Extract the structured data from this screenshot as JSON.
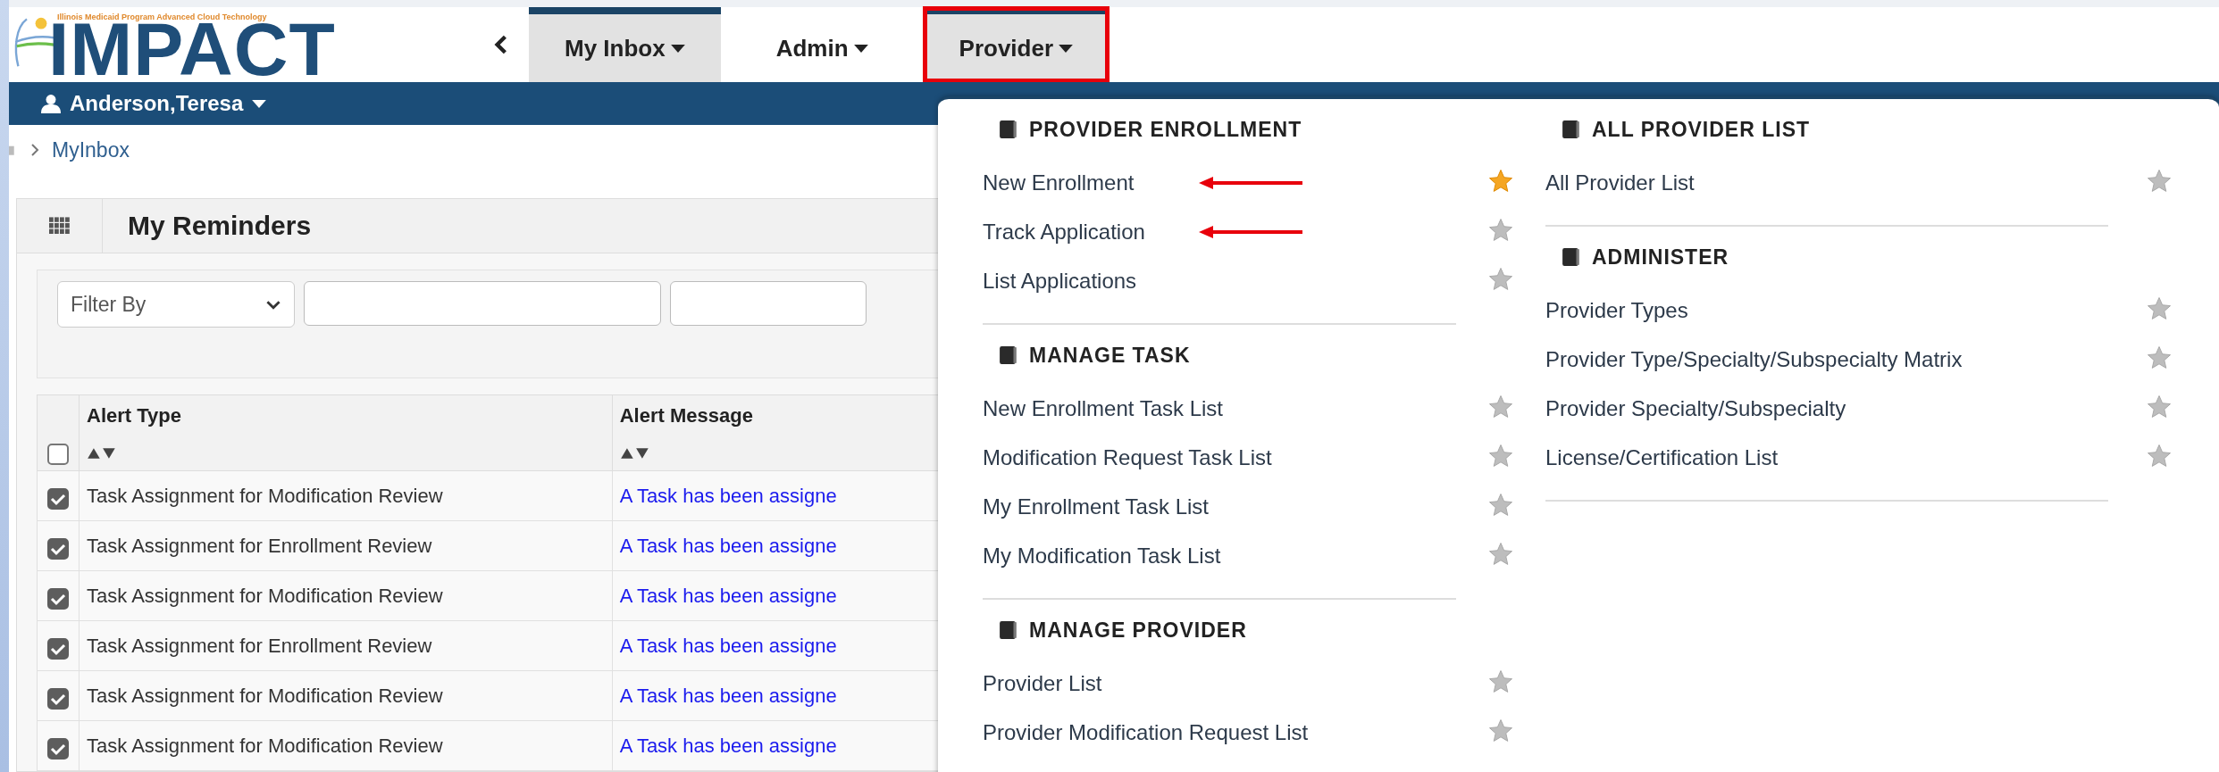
{
  "logo": {
    "name": "IMPACT",
    "tagline": "Illinois Medicaid Program Advanced Cloud Technology"
  },
  "nav": [
    {
      "label": "My Inbox",
      "selected": true,
      "highlighted": false
    },
    {
      "label": "Admin",
      "selected": false,
      "highlighted": false
    },
    {
      "label": "Provider",
      "selected": true,
      "highlighted": true
    }
  ],
  "user": {
    "name": "Anderson,Teresa"
  },
  "breadcrumb": {
    "current": "MyInbox"
  },
  "panel": {
    "title": "My Reminders",
    "filter": {
      "placeholder": "Filter By"
    },
    "table": {
      "columns": [
        "Alert Type",
        "Alert Message"
      ],
      "header_checked": false,
      "rows": [
        {
          "checked": true,
          "alert_type": "Task Assignment for Modification Review",
          "alert_message": "A Task has been assigne"
        },
        {
          "checked": true,
          "alert_type": "Task Assignment for Enrollment Review",
          "alert_message": "A Task has been assigne"
        },
        {
          "checked": true,
          "alert_type": "Task Assignment for Modification Review",
          "alert_message": "A Task has been assigne"
        },
        {
          "checked": true,
          "alert_type": "Task Assignment for Enrollment Review",
          "alert_message": "A Task has been assigne"
        },
        {
          "checked": true,
          "alert_type": "Task Assignment for Modification Review",
          "alert_message": "A Task has been assigne"
        },
        {
          "checked": true,
          "alert_type": "Task Assignment for Modification Review",
          "alert_message": "A Task has been assigne"
        }
      ]
    }
  },
  "menu": {
    "columns": [
      [
        {
          "heading": "PROVIDER ENROLLMENT",
          "items": [
            {
              "label": "New Enrollment",
              "starred": true,
              "arrow": true
            },
            {
              "label": "Track Application",
              "starred": false,
              "arrow": true
            },
            {
              "label": "List Applications",
              "starred": false,
              "arrow": false
            }
          ]
        },
        {
          "heading": "MANAGE TASK",
          "items": [
            {
              "label": "New Enrollment Task List",
              "starred": false,
              "arrow": false
            },
            {
              "label": "Modification Request Task List",
              "starred": false,
              "arrow": false
            },
            {
              "label": "My Enrollment Task List",
              "starred": false,
              "arrow": false
            },
            {
              "label": "My Modification Task List",
              "starred": false,
              "arrow": false
            }
          ]
        },
        {
          "heading": "MANAGE PROVIDER",
          "items": [
            {
              "label": "Provider List",
              "starred": false,
              "arrow": false
            },
            {
              "label": "Provider Modification Request List",
              "starred": false,
              "arrow": false
            }
          ]
        }
      ],
      [
        {
          "heading": "ALL PROVIDER LIST",
          "items": [
            {
              "label": "All Provider List",
              "starred": false,
              "arrow": false
            }
          ]
        },
        {
          "heading": "ADMINISTER",
          "items": [
            {
              "label": "Provider Types",
              "starred": false,
              "arrow": false
            },
            {
              "label": "Provider Type/Specialty/Subspecialty Matrix",
              "starred": false,
              "arrow": false
            },
            {
              "label": "Provider Specialty/Subspecialty",
              "starred": false,
              "arrow": false
            },
            {
              "label": "License/Certification List",
              "starred": false,
              "arrow": false
            }
          ]
        }
      ]
    ]
  }
}
